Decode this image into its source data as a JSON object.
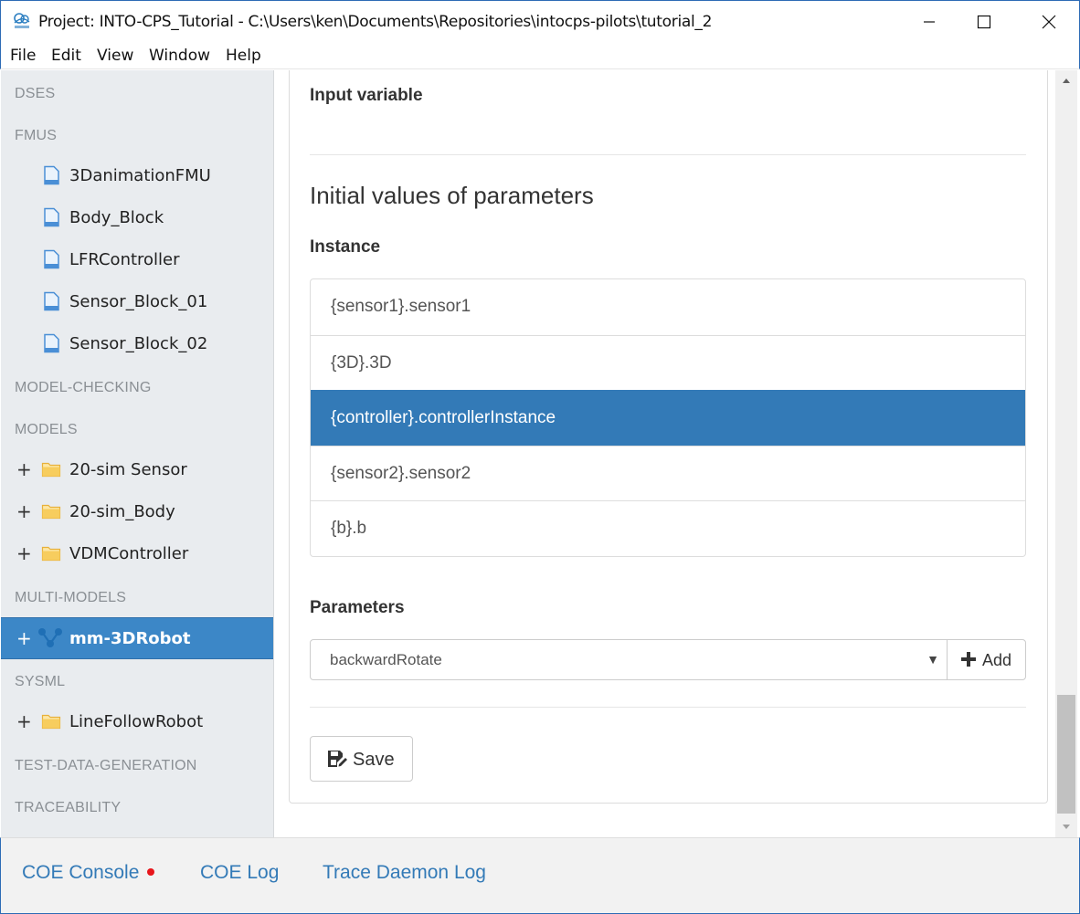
{
  "window": {
    "title": "Project: INTO-CPS_Tutorial - C:\\Users\\ken\\Documents\\Repositories\\intocps-pilots\\tutorial_2"
  },
  "menu": [
    "File",
    "Edit",
    "View",
    "Window",
    "Help"
  ],
  "sidebar": {
    "sections": {
      "dses": "DSES",
      "fmus": "FMUS",
      "model_checking": "MODEL-CHECKING",
      "models": "MODELS",
      "multi_models": "MULTI-MODELS",
      "sysml": "SYSML",
      "test_data_generation": "TEST-DATA-GENERATION",
      "traceability": "TRACEABILITY"
    },
    "fmus": [
      "3DanimationFMU",
      "Body_Block",
      "LFRController",
      "Sensor_Block_01",
      "Sensor_Block_02"
    ],
    "models": [
      "20-sim Sensor",
      "20-sim_Body",
      "VDMController"
    ],
    "multi_models": [
      "mm-3DRobot"
    ],
    "sysml": [
      "LineFollowRobot"
    ],
    "expander": "+"
  },
  "main": {
    "input_variable_label": "Input variable",
    "initial_values_title": "Initial values of parameters",
    "instance_label": "Instance",
    "instances": [
      "{sensor1}.sensor1",
      "{3D}.3D",
      "{controller}.controllerInstance",
      "{sensor2}.sensor2",
      "{b}.b"
    ],
    "selected_instance_index": 2,
    "parameters_label": "Parameters",
    "parameter_select_value": "backwardRotate",
    "add_label": "Add",
    "save_label": "Save"
  },
  "bottom": {
    "coe_console": "COE Console",
    "coe_log": "COE Log",
    "trace_daemon_log": "Trace Daemon Log"
  },
  "colors": {
    "accent": "#337ab7",
    "sidebar_active": "#3c87c7",
    "status_dot": "#e8161b",
    "folder": "#f5c342",
    "file": "#4a8fd6"
  }
}
